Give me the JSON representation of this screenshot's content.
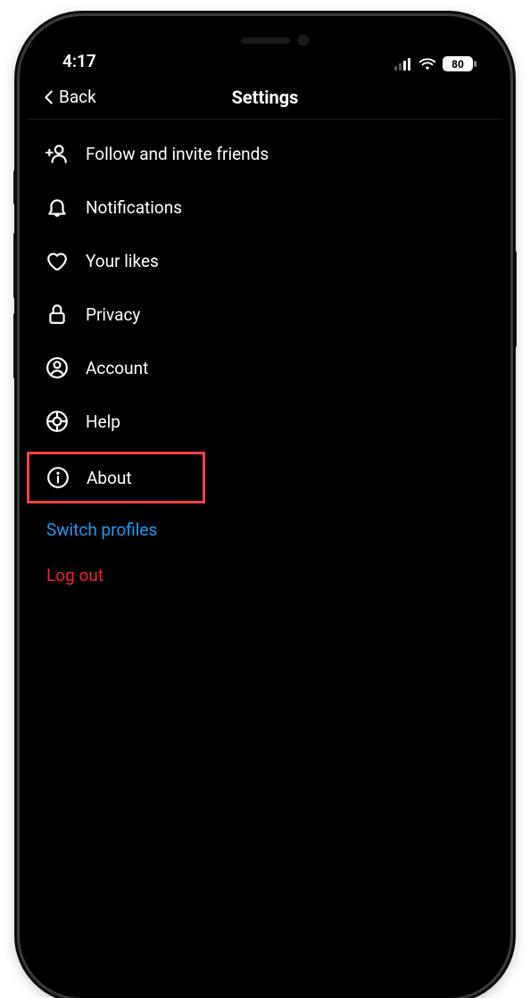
{
  "status": {
    "time": "4:17",
    "battery": "80"
  },
  "nav": {
    "back": "Back",
    "title": "Settings"
  },
  "menu": {
    "follow": "Follow and invite friends",
    "notifications": "Notifications",
    "likes": "Your likes",
    "privacy": "Privacy",
    "account": "Account",
    "help": "Help",
    "about": "About"
  },
  "actions": {
    "switch_profiles": "Switch profiles",
    "log_out": "Log out"
  }
}
